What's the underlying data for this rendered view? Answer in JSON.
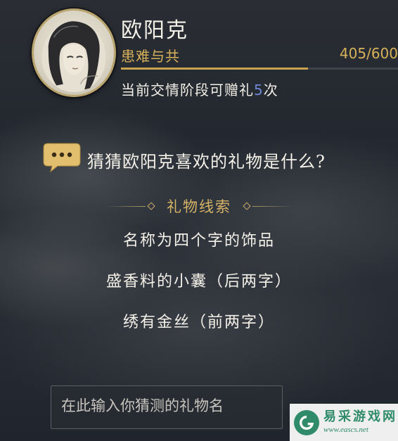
{
  "header": {
    "name": "欧阳克",
    "relationship": "患难与共",
    "affinity_current": "405",
    "affinity_max": "600",
    "affinity_fraction": 0.675,
    "gift_text_prefix": "当前交情阶段可赠礼",
    "gift_count": "5",
    "gift_text_suffix": "次"
  },
  "question": {
    "text": "猜猜欧阳克喜欢的礼物是什么?"
  },
  "clues": {
    "title": "礼物线索",
    "items": [
      "名称为四个字的饰品",
      "盛香料的小囊（后两字）",
      "绣有金丝（前两字）"
    ]
  },
  "input": {
    "placeholder": "在此输入你猜测的礼物名",
    "value": ""
  },
  "watermark": {
    "cn": "易采游戏网",
    "url": "www.eascs.net"
  },
  "colors": {
    "gold": "#d8b25a",
    "count_blue": "#6f86d6",
    "text": "#f4f1e8"
  }
}
